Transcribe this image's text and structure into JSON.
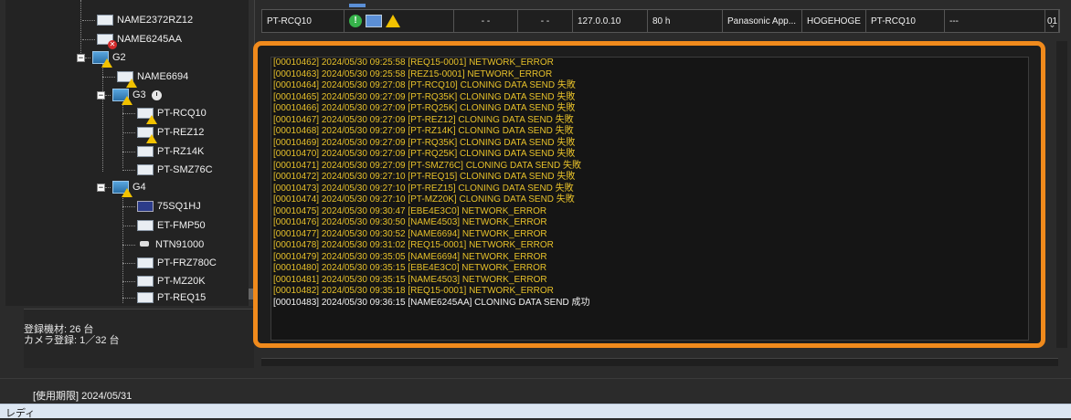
{
  "tree": {
    "items": [
      {
        "label": "NAME2372RZ12",
        "icon": "projector-icon",
        "badge": ""
      },
      {
        "label": "NAME6245AA",
        "icon": "projector-icon",
        "badge": "error"
      },
      {
        "label": "G2",
        "icon": "group-icon",
        "badge": "warning",
        "expander": "-"
      },
      {
        "label": "NAME6694",
        "icon": "projector-icon",
        "badge": "warning"
      },
      {
        "label": "G3",
        "icon": "group-icon",
        "badge": "warning",
        "expander": "-",
        "extra": "clock-icon"
      },
      {
        "label": "PT-RCQ10",
        "icon": "projector-icon",
        "badge": "warning"
      },
      {
        "label": "PT-REZ12",
        "icon": "projector-icon",
        "badge": "warning"
      },
      {
        "label": "PT-RZ14K",
        "icon": "projector-icon",
        "badge": ""
      },
      {
        "label": "PT-SMZ76C",
        "icon": "projector-icon",
        "badge": ""
      },
      {
        "label": "G4",
        "icon": "group-icon",
        "badge": "warning",
        "expander": "-"
      },
      {
        "label": "75SQ1HJ",
        "icon": "display-icon",
        "badge": ""
      },
      {
        "label": "ET-FMP50",
        "icon": "box-icon",
        "badge": ""
      },
      {
        "label": "NTN91000",
        "icon": "camera-icon",
        "badge": ""
      },
      {
        "label": "PT-FRZ780C",
        "icon": "projector-icon",
        "badge": ""
      },
      {
        "label": "PT-MZ20K",
        "icon": "projector-icon",
        "badge": ""
      },
      {
        "label": "PT-REQ15",
        "icon": "projector-icon",
        "badge": ""
      }
    ]
  },
  "info": {
    "registered": "登録機材: 26 台",
    "camera": "カメラ登録: 1／32 台"
  },
  "table": {
    "row": {
      "name": "PT-RCQ10",
      "col3": "- -",
      "col4": "- -",
      "ip": "127.0.0.10",
      "hours": "80 h",
      "maker": "Panasonic App...",
      "user": "HOGEHOGE",
      "model": "PT-RCQ10",
      "extra": "---",
      "last": "01"
    }
  },
  "log": {
    "lines": [
      {
        "text": "[00010462] 2024/05/30 09:25:58 [REQ15-0001] NETWORK_ERROR",
        "level": "warn"
      },
      {
        "text": "[00010463] 2024/05/30 09:25:58 [REZ15-0001] NETWORK_ERROR",
        "level": "warn"
      },
      {
        "text": "[00010464] 2024/05/30 09:27:08 [PT-RCQ10] CLONING DATA SEND 失敗",
        "level": "warn"
      },
      {
        "text": "[00010465] 2024/05/30 09:27:09 [PT-RQ35K] CLONING DATA SEND 失敗",
        "level": "warn"
      },
      {
        "text": "[00010466] 2024/05/30 09:27:09 [PT-RQ25K] CLONING DATA SEND 失敗",
        "level": "warn"
      },
      {
        "text": "[00010467] 2024/05/30 09:27:09 [PT-REZ12] CLONING DATA SEND 失敗",
        "level": "warn"
      },
      {
        "text": "[00010468] 2024/05/30 09:27:09 [PT-RZ14K] CLONING DATA SEND 失敗",
        "level": "warn"
      },
      {
        "text": "[00010469] 2024/05/30 09:27:09 [PT-RQ35K] CLONING DATA SEND 失敗",
        "level": "warn"
      },
      {
        "text": "[00010470] 2024/05/30 09:27:09 [PT-RQ25K] CLONING DATA SEND 失敗",
        "level": "warn"
      },
      {
        "text": "[00010471] 2024/05/30 09:27:09 [PT-SMZ76C] CLONING DATA SEND 失敗",
        "level": "warn"
      },
      {
        "text": "[00010472] 2024/05/30 09:27:10 [PT-REQ15] CLONING DATA SEND 失敗",
        "level": "warn"
      },
      {
        "text": "[00010473] 2024/05/30 09:27:10 [PT-REZ15] CLONING DATA SEND 失敗",
        "level": "warn"
      },
      {
        "text": "[00010474] 2024/05/30 09:27:10 [PT-MZ20K] CLONING DATA SEND 失敗",
        "level": "warn"
      },
      {
        "text": "[00010475] 2024/05/30 09:30:47 [EBE4E3C0] NETWORK_ERROR",
        "level": "warn"
      },
      {
        "text": "[00010476] 2024/05/30 09:30:50 [NAME4503] NETWORK_ERROR",
        "level": "warn"
      },
      {
        "text": "[00010477] 2024/05/30 09:30:52 [NAME6694] NETWORK_ERROR",
        "level": "warn"
      },
      {
        "text": "[00010478] 2024/05/30 09:31:02 [REQ15-0001] NETWORK_ERROR",
        "level": "warn"
      },
      {
        "text": "[00010479] 2024/05/30 09:35:05 [NAME6694] NETWORK_ERROR",
        "level": "warn"
      },
      {
        "text": "[00010480] 2024/05/30 09:35:15 [EBE4E3C0] NETWORK_ERROR",
        "level": "warn"
      },
      {
        "text": "[00010481] 2024/05/30 09:35:15 [NAME4503] NETWORK_ERROR",
        "level": "warn"
      },
      {
        "text": "[00010482] 2024/05/30 09:35:18 [REQ15-0001] NETWORK_ERROR",
        "level": "warn"
      },
      {
        "text": "[00010483] 2024/05/30 09:36:15 [NAME6245AA] CLONING DATA SEND 成功",
        "level": "ok"
      }
    ]
  },
  "footer": {
    "expiry": "[使用期限] 2024/05/31",
    "status": "レディ"
  },
  "colors": {
    "highlight": "#f08a1c",
    "log_warn": "#e6c02a",
    "log_ok": "#f2f2f2"
  }
}
